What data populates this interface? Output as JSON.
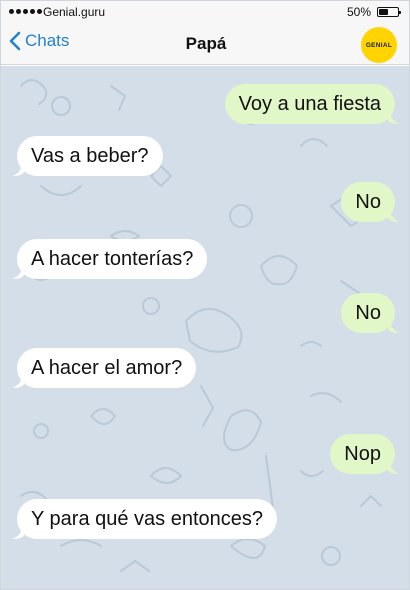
{
  "status_bar": {
    "carrier": "Genial.guru",
    "battery_percent": "50%",
    "battery_level": 0.5
  },
  "nav": {
    "back_label": "Chats",
    "title": "Papá",
    "logo_text": "GENIAL"
  },
  "colors": {
    "accent": "#2481cc",
    "incoming_bubble": "#ffffff",
    "outgoing_bubble": "#e1f7c8",
    "chat_background": "#d3dee8",
    "logo": "#ffd400"
  },
  "messages": [
    {
      "direction": "out",
      "text": "Voy a una fiesta"
    },
    {
      "direction": "in",
      "text": "Vas a beber?"
    },
    {
      "direction": "out",
      "text": "No"
    },
    {
      "direction": "in",
      "text": "A hacer tonterías?"
    },
    {
      "direction": "out",
      "text": "No"
    },
    {
      "direction": "in",
      "text": "A hacer el amor?"
    },
    {
      "direction": "out",
      "text": "Nop"
    },
    {
      "direction": "in",
      "text": "Y para qué vas entonces?"
    }
  ]
}
